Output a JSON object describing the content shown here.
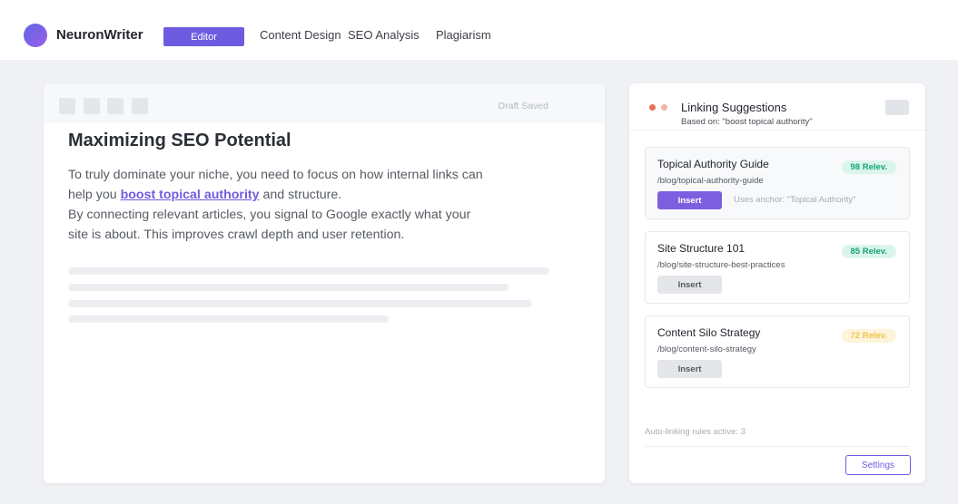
{
  "header": {
    "brand": "NeuronWriter",
    "nav": [
      {
        "label": "Editor",
        "active": true
      },
      {
        "label": "Content Design",
        "active": false
      },
      {
        "label": "SEO Analysis",
        "active": false
      },
      {
        "label": "Plagiarism",
        "active": false
      }
    ]
  },
  "editor": {
    "status": "Draft Saved",
    "title": "Maximizing SEO Potential",
    "para1_before": "To truly dominate your niche, you need to focus on how internal links can help you ",
    "para1_link": "boost topical authority",
    "para1_after": " and structure.",
    "para2": "By connecting relevant articles, you signal to Google exactly what your site is about. This improves crawl depth and user retention."
  },
  "panel": {
    "title": "Linking Suggestions",
    "subtitle": "Based on: \"boost topical authority\"",
    "suggestions": [
      {
        "title": "Topical Authority Guide",
        "path": "/blog/topical-authority-guide",
        "relevance": "98 Relev.",
        "button": "Insert",
        "anchor_note": "Uses anchor: \"Topical Authority\""
      },
      {
        "title": "Site Structure 101",
        "path": "/blog/site-structure-best-practices",
        "relevance": "85 Relev.",
        "button": "Insert"
      },
      {
        "title": "Content Silo Strategy",
        "path": "/blog/content-silo-strategy",
        "relevance": "72 Relev.",
        "button": "Insert"
      }
    ],
    "rules_status": "Auto-linking rules active: 3",
    "settings_label": "Settings"
  },
  "colors": {
    "accent": "#6e5ce0",
    "badge_high": "#10b981",
    "badge_mid": "#10b981",
    "badge_low": "#f5c542"
  }
}
